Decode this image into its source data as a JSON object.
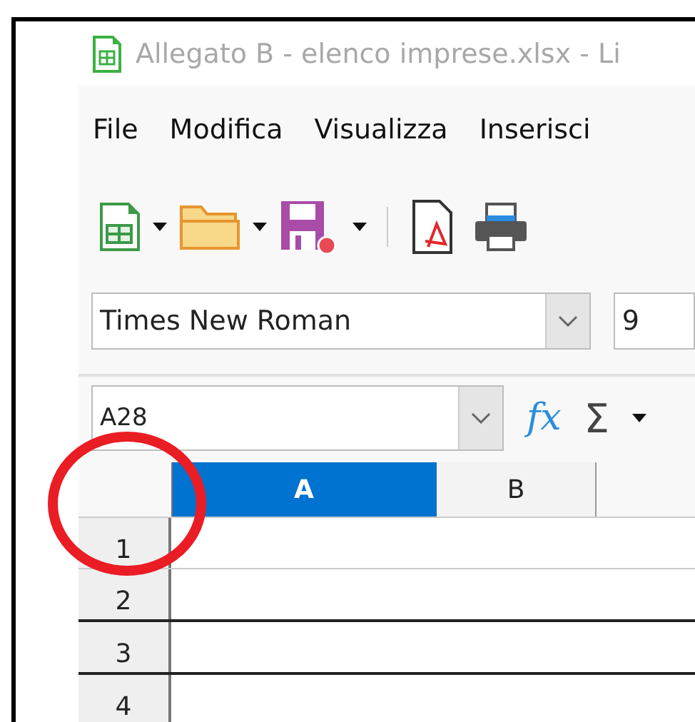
{
  "window": {
    "title": "Allegato B - elenco imprese.xlsx - Li"
  },
  "menu": [
    {
      "label": "File"
    },
    {
      "label": "Modifica"
    },
    {
      "label": "Visualizza"
    },
    {
      "label": "Inserisci"
    }
  ],
  "font_bar": {
    "font_name": "Times New Roman",
    "font_size": "9"
  },
  "formula_bar": {
    "name_box": "A28",
    "function_symbol": "fx",
    "sum_symbol": "Σ"
  },
  "sheet": {
    "columns": [
      {
        "label": "A",
        "selected": true
      },
      {
        "label": "B",
        "selected": false
      }
    ],
    "rows": [
      {
        "label": "1"
      },
      {
        "label": "2"
      },
      {
        "label": "3"
      },
      {
        "label": "4"
      }
    ]
  },
  "annotation": {
    "kind": "circle",
    "color": "#ea1c24"
  }
}
